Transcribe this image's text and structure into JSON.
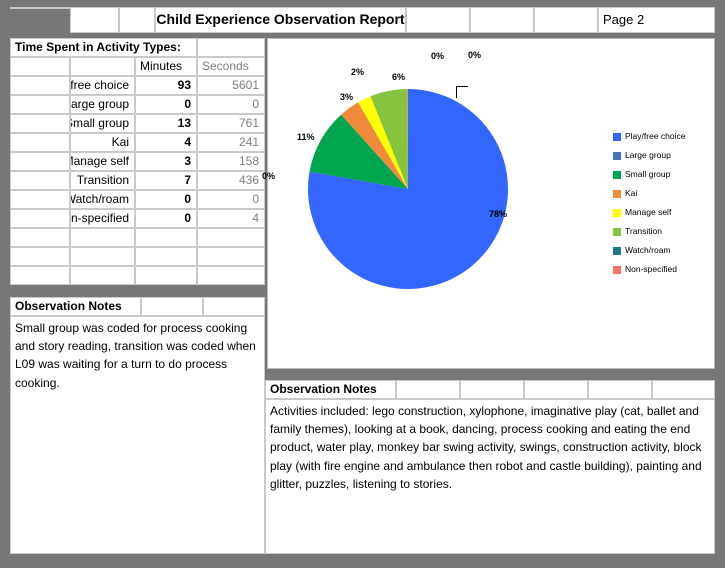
{
  "header": {
    "title": "Child Experience Observation Report",
    "page_label": "Page 2",
    "empty_cells": [
      "",
      "",
      "",
      "",
      "",
      ""
    ]
  },
  "activity_table": {
    "title": "Time Spent in Activity Types:",
    "columns": [
      "",
      "",
      "Minutes",
      "Seconds"
    ],
    "rows": [
      {
        "label": "Play/free choice",
        "minutes": "93",
        "seconds": "5601"
      },
      {
        "label": "Large group",
        "minutes": "0",
        "seconds": "0"
      },
      {
        "label": "Small group",
        "minutes": "13",
        "seconds": "761"
      },
      {
        "label": "Kai",
        "minutes": "4",
        "seconds": "241"
      },
      {
        "label": "Manage self",
        "minutes": "3",
        "seconds": "158"
      },
      {
        "label": "Transition",
        "minutes": "7",
        "seconds": "436"
      },
      {
        "label": "Watch/roam",
        "minutes": "0",
        "seconds": "0"
      },
      {
        "label": "Non-specified",
        "minutes": "0",
        "seconds": "4"
      }
    ],
    "blank_rows": 3
  },
  "notes_left": {
    "heading": "Observation Notes",
    "body": "Small group was coded for process cooking and story reading, transition was coded when L09 was waiting for a turn to do process cooking."
  },
  "notes_right": {
    "heading": "Observation Notes",
    "body": "Activities included: lego construction, xylophone, imaginative play (cat, ballet and family themes), looking at a book, dancing, process cooking and eating the end product, water play, monkey bar swing activity, swings, construction activity, block play (with fire engine and ambulance then robot and castle building), painting and glitter, puzzles, listening to stories."
  },
  "chart_data": {
    "type": "pie",
    "title": "",
    "legend_position": "right",
    "categories": [
      "Play/free choice",
      "Large group",
      "Small group",
      "Kai",
      "Manage self",
      "Transition",
      "Watch/roam",
      "Non-specified"
    ],
    "values": [
      5601,
      0,
      761,
      241,
      158,
      436,
      0,
      4
    ],
    "value_unit": "seconds",
    "percent_labels": [
      "78%",
      "0%",
      "11%",
      "3%",
      "2%",
      "6%",
      "0%",
      "0%"
    ],
    "colors": [
      "#3366ff",
      "#4575b4",
      "#00a550",
      "#f08b3c",
      "#ffff00",
      "#86c440",
      "#1f7b8c",
      "#f4746a"
    ],
    "legend_entries": [
      {
        "label": "Play/free choice",
        "color": "#3366ff"
      },
      {
        "label": "Large group",
        "color": "#4575b4"
      },
      {
        "label": "Small group",
        "color": "#00a550"
      },
      {
        "label": "Kai",
        "color": "#f08b3c"
      },
      {
        "label": "Manage self",
        "color": "#ffff00"
      },
      {
        "label": "Transition",
        "color": "#86c440"
      },
      {
        "label": "Watch/roam",
        "color": "#1f7b8c"
      },
      {
        "label": "Non-specified",
        "color": "#f4746a"
      }
    ],
    "slice_label_78": "78%",
    "slice_label_0a": "0%",
    "slice_label_11": "11%",
    "slice_label_3": "3%",
    "slice_label_2": "2%",
    "slice_label_6": "6%",
    "slice_label_0b": "0%",
    "slice_label_0c": "0%"
  }
}
